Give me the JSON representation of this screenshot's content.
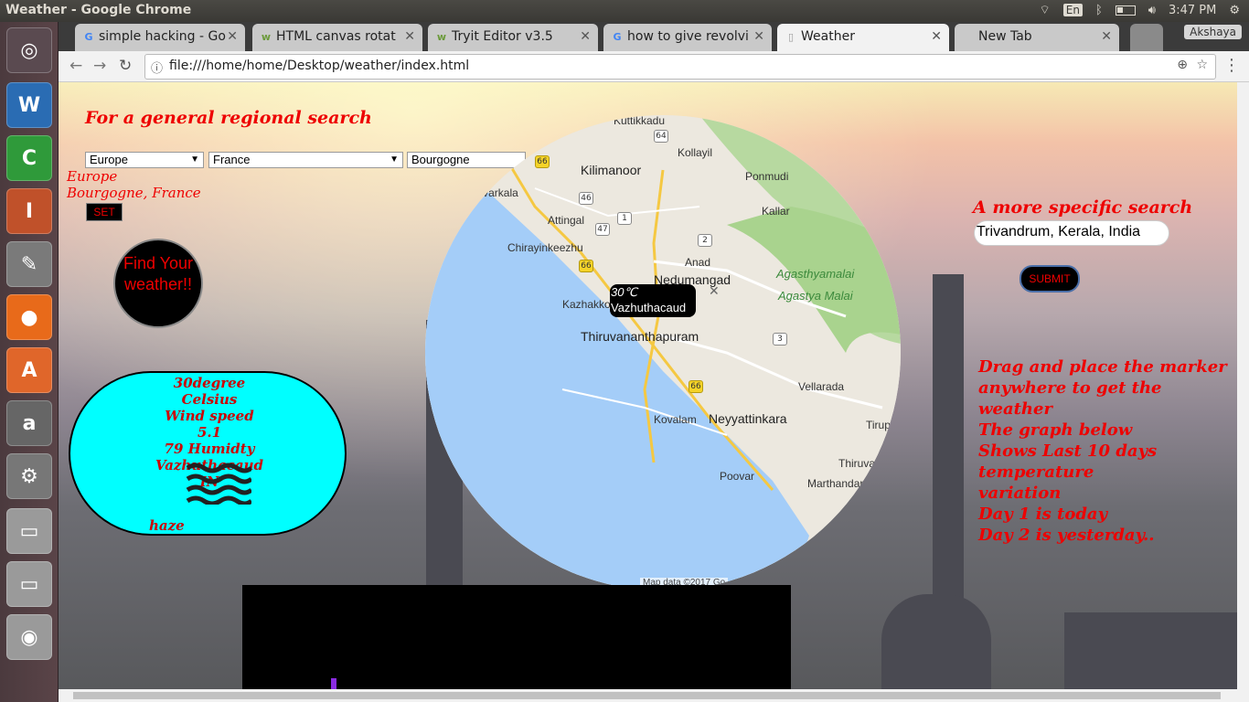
{
  "system": {
    "window_title": "Weather - Google Chrome",
    "lang": "En",
    "time": "3:47 PM"
  },
  "launcher": {
    "apps": [
      {
        "name": "ubuntu-dash-icon",
        "glyph": "◎",
        "color": "#5a4a50"
      },
      {
        "name": "libreoffice-writer-icon",
        "glyph": "W",
        "color": "#2a6cb3"
      },
      {
        "name": "libreoffice-calc-icon",
        "glyph": "C",
        "color": "#2f9a3a"
      },
      {
        "name": "libreoffice-impress-icon",
        "glyph": "I",
        "color": "#c0512a"
      },
      {
        "name": "text-editor-icon",
        "glyph": "✎",
        "color": "#7a7a7a"
      },
      {
        "name": "firefox-icon",
        "glyph": "●",
        "color": "#e86a1a"
      },
      {
        "name": "software-center-icon",
        "glyph": "A",
        "color": "#e0662a"
      },
      {
        "name": "amazon-icon",
        "glyph": "a",
        "color": "#666"
      },
      {
        "name": "system-settings-icon",
        "glyph": "⚙",
        "color": "#777"
      },
      {
        "name": "drive-icon",
        "glyph": "▭",
        "color": "#9a9a9a"
      },
      {
        "name": "drive-icon-2",
        "glyph": "▭",
        "color": "#9a9a9a"
      },
      {
        "name": "dvd-icon",
        "glyph": "◉",
        "color": "#9a9a9a"
      }
    ]
  },
  "browser": {
    "tabs": [
      {
        "label": "simple hacking - Go",
        "fav": "G",
        "favcolor": "#4285f4"
      },
      {
        "label": "HTML canvas rotat",
        "fav": "w",
        "favcolor": "#6b9a3a"
      },
      {
        "label": "Tryit Editor v3.5",
        "fav": "w",
        "favcolor": "#6b9a3a"
      },
      {
        "label": "how to give revolvi",
        "fav": "G",
        "favcolor": "#4285f4"
      },
      {
        "label": "Weather",
        "fav": "▯",
        "favcolor": "#999"
      },
      {
        "label": "New Tab",
        "fav": "",
        "favcolor": "#999"
      }
    ],
    "user": "Akshaya",
    "url": "file:///home/home/Desktop/weather/index.html"
  },
  "page": {
    "general": {
      "title": "For a general regional search",
      "region": "Europe",
      "country": "France",
      "city": "Bourgogne",
      "region_text": "Europe",
      "place_text": "Bourgogne, France",
      "set_label": "SET"
    },
    "find_label": "Find Your weather!!",
    "weather": {
      "temp": "30degree Celsius",
      "wind": "Wind speed 5.1",
      "humidity": "79 Humidty",
      "place": "Vazhuthacaud IN",
      "condition": "haze"
    },
    "map": {
      "info_temp": "30℃",
      "info_place": "Vazhuthacaud",
      "attribution": "Map data ©2017 Go",
      "labels": [
        {
          "id": "kuttikkadu",
          "text": "Kuttikkadu"
        },
        {
          "id": "kollayil",
          "text": "Kollayil"
        },
        {
          "id": "kilimanoor",
          "text": "Kilimanoor"
        },
        {
          "id": "ponmudi",
          "text": "Ponmudi"
        },
        {
          "id": "varkala",
          "text": "Varkala"
        },
        {
          "id": "kallar",
          "text": "Kallar"
        },
        {
          "id": "attingal",
          "text": "Attingal"
        },
        {
          "id": "chirayinkeezhu",
          "text": "Chirayinkeezhu"
        },
        {
          "id": "anad",
          "text": "Anad"
        },
        {
          "id": "nedumangad",
          "text": "Nedumangad"
        },
        {
          "id": "kazhakkoottam",
          "text": "Kazhakko"
        },
        {
          "id": "thiruvananthapuram",
          "text": "Thiruvananthapuram"
        },
        {
          "id": "vellarada",
          "text": "Vellarada"
        },
        {
          "id": "kovalam",
          "text": "Kovalam"
        },
        {
          "id": "neyyattinkara",
          "text": "Neyyattinkara"
        },
        {
          "id": "thirupuram",
          "text": "Tirupu"
        },
        {
          "id": "poovar",
          "text": "Poovar"
        },
        {
          "id": "marthandam",
          "text": "Marthandan"
        },
        {
          "id": "thiruvattar",
          "text": "Thiruva"
        },
        {
          "id": "agasthyamalai",
          "text": "Agasthyamalai"
        },
        {
          "id": "agastya_malai",
          "text": "Agastya Malai"
        }
      ]
    },
    "specific": {
      "title": "A more specific search",
      "input_value": "Trivandrum, Kerala, India",
      "submit_label": "SUBMIT"
    },
    "help_lines": [
      "Drag and place the marker",
      "anywhere to get the weather",
      "The graph below",
      "Shows Last 10 days temperature",
      "variation",
      "Day 1 is today",
      "Day 2 is yesterday.."
    ]
  }
}
